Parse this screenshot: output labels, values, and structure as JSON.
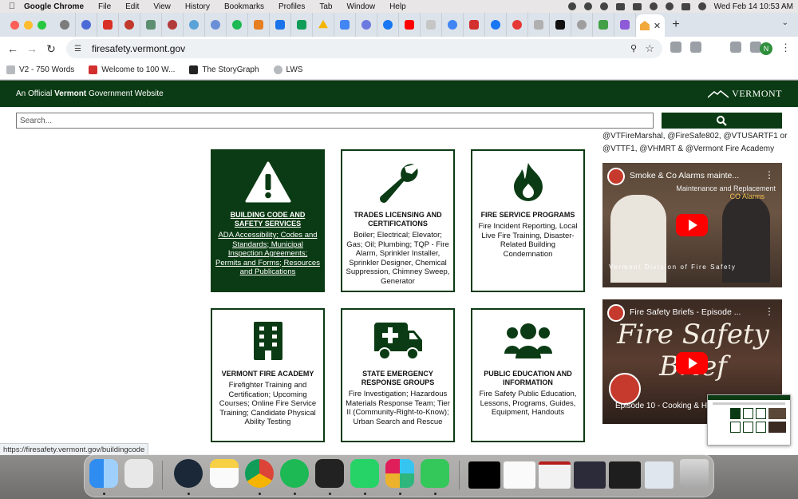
{
  "menubar": {
    "app": "Google Chrome",
    "items": [
      "File",
      "Edit",
      "View",
      "History",
      "Bookmarks",
      "Profiles",
      "Tab",
      "Window",
      "Help"
    ],
    "clock": "Wed Feb 14  10:53 AM"
  },
  "browser": {
    "url": "firesafety.vermont.gov",
    "bookmarks": [
      "V2 - 750 Words",
      "Welcome to 100 W...",
      "The StoryGraph",
      "LWS"
    ],
    "profile_initial": "N",
    "status_url": "https://firesafety.vermont.gov/buildingcode"
  },
  "site": {
    "official_prefix": "An Official ",
    "official_bold": "Vermont",
    "official_suffix": " Government Website",
    "logo_text": "VERMONT",
    "search_placeholder": "Search...",
    "sidebar_text": "@VTFireMarshal, @FireSafe802, @VTUSARTF1 or @VTTF1, @VHMRT & @Vermont Fire Academy"
  },
  "cards": [
    {
      "title": "BUILDING CODE AND SAFETY SERVICES",
      "desc": "ADA Accessibility; Codes and Standards; Municipal Inspection Agreements; Permits and Forms; Resources and Publications",
      "icon": "warning-icon"
    },
    {
      "title": "TRADES LICENSING AND CERTIFICATIONS",
      "desc": "Boiler; Electrical; Elevator; Gas; Oil; Plumbing; TQP - Fire Alarm, Sprinkler Installer, Sprinkler Designer, Chemical Suppression, Chimney Sweep, Generator",
      "icon": "wrench-icon"
    },
    {
      "title": "FIRE SERVICE PROGRAMS",
      "desc": "Fire Incident Reporting, Local Live Fire Training, Disaster-Related Building Condemnation",
      "icon": "flame-icon"
    },
    {
      "title": "VERMONT FIRE ACADEMY",
      "desc": "Firefighter Training and Certification; Upcoming Courses; Online Fire Service Training; Candidate Physical Ability Testing",
      "icon": "building-icon"
    },
    {
      "title": "STATE EMERGENCY RESPONSE GROUPS",
      "desc": "Fire Investigation; Hazardous Materials Response Team; Tier II (Community-Right-to-Know); Urban Search and Rescue",
      "icon": "ambulance-icon"
    },
    {
      "title": "PUBLIC EDUCATION AND INFORMATION",
      "desc": "Fire Safety Public Education, Lessons, Programs, Guides, Equipment, Handouts",
      "icon": "users-icon"
    }
  ],
  "videos": [
    {
      "title": "Smoke & Co Alarms mainte...",
      "overlay_top": "Maintenance and Replacement",
      "overlay_sub": "CO Alarms",
      "caption": "Vermont Division of Fire Safety"
    },
    {
      "title": "Fire Safety Briefs - Episode ...",
      "overlay_big": "Fire Safety Brief",
      "caption": "Episode 10 - Cooking & H"
    }
  ]
}
